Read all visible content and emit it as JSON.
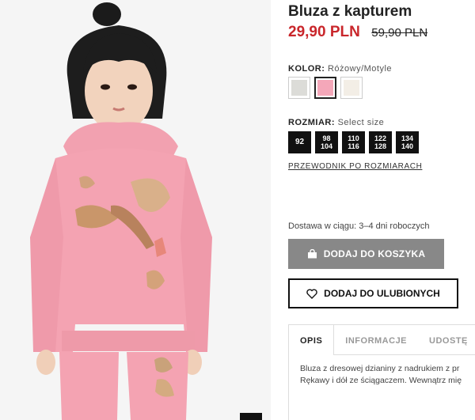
{
  "product": {
    "title": "Bluza z kapturem",
    "price_current": "29,90 PLN",
    "price_old": "59,90 PLN"
  },
  "color": {
    "label": "KOLOR:",
    "value": "Różowy/Motyle",
    "swatches": [
      {
        "name": "light-grey",
        "hex": "#dcdcd8",
        "selected": false
      },
      {
        "name": "pink",
        "hex": "#f4a7b9",
        "selected": true
      },
      {
        "name": "cream",
        "hex": "#f3eee6",
        "selected": false
      }
    ]
  },
  "size": {
    "label": "ROZMIAR:",
    "value": "Select size",
    "options": [
      {
        "line1": "92",
        "line2": ""
      },
      {
        "line1": "98",
        "line2": "104"
      },
      {
        "line1": "110",
        "line2": "116"
      },
      {
        "line1": "122",
        "line2": "128"
      },
      {
        "line1": "134",
        "line2": "140"
      }
    ],
    "guide_link": "PRZEWODNIK PO ROZMIARACH"
  },
  "delivery": "Dostawa w ciągu: 3–4 dni roboczych",
  "buttons": {
    "add_to_cart": "DODAJ DO KOSZYKA",
    "add_to_favorites": "DODAJ DO ULUBIONYCH"
  },
  "tabs": [
    {
      "label": "OPIS",
      "active": true
    },
    {
      "label": "INFORMACJE",
      "active": false
    },
    {
      "label": "UDOSTĘ",
      "active": false
    }
  ],
  "description": {
    "line1": "Bluza z dresowej dzianiny z nadrukiem z pr",
    "line2": "Rękawy i dół ze ściągaczem. Wewnątrz mię"
  },
  "colors": {
    "price_red": "#c9262b",
    "cart_button_bg": "#888888",
    "hoodie_pink": "#f4a3b2"
  }
}
